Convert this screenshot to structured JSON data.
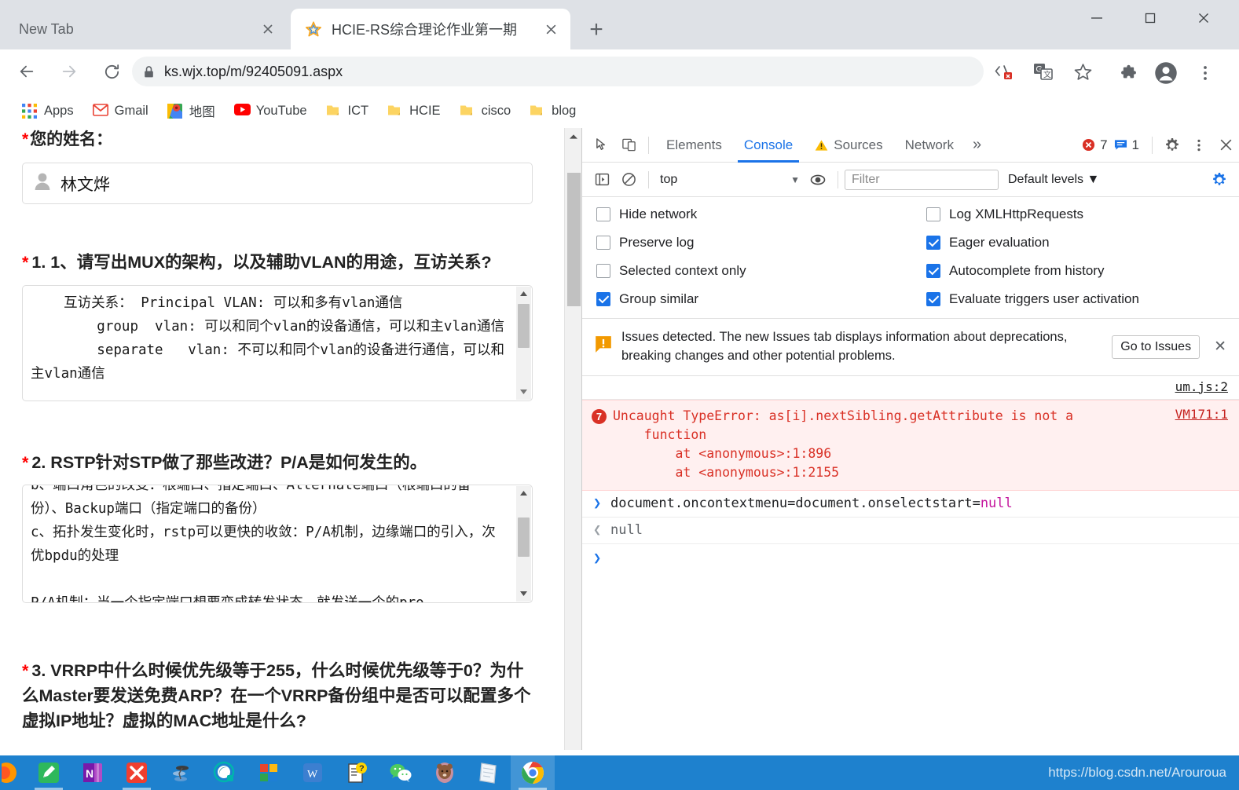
{
  "browser": {
    "tabs": [
      {
        "title": "New Tab",
        "active": false,
        "favicon": "none"
      },
      {
        "title": "HCIE-RS综合理论作业第一期",
        "active": true,
        "favicon": "star-icon"
      }
    ],
    "new_tab_label": "+",
    "window_controls": {
      "minimize": "—",
      "maximize": "□",
      "close": "✕"
    },
    "nav": {
      "back": "←",
      "forward": "→",
      "reload": "⟳"
    },
    "omnibox": {
      "url": "ks.wjx.top/m/92405091.aspx",
      "lock": "lock-icon"
    },
    "omnibox_actions": [
      "devtools-source-icon",
      "translate-icon",
      "bookmark-star-icon"
    ],
    "toolbar_icons": [
      "extensions-puzzle-icon",
      "profile-avatar-icon",
      "chrome-menu-icon"
    ],
    "bookmarks": [
      {
        "label": "Apps",
        "icon": "apps-grid-icon"
      },
      {
        "label": "Gmail",
        "icon": "gmail-icon"
      },
      {
        "label": "地图",
        "icon": "google-maps-icon"
      },
      {
        "label": "YouTube",
        "icon": "youtube-icon"
      },
      {
        "label": "ICT",
        "icon": "folder-icon"
      },
      {
        "label": "HCIE",
        "icon": "folder-icon"
      },
      {
        "label": "cisco",
        "icon": "folder-icon"
      },
      {
        "label": "blog",
        "icon": "folder-icon"
      }
    ]
  },
  "page": {
    "name_field": {
      "label": "您的姓名：",
      "required_marker": "*",
      "value": "林文烨",
      "icon": "person-icon"
    },
    "questions": [
      {
        "required_marker": "*",
        "number": "1.",
        "title": "1、请写出MUX的架构，以及辅助VLAN的用途，互访关系?",
        "answer": "    互访关系： Principal VLAN: 可以和多有vlan通信\n        group  vlan: 可以和同个vlan的设备通信，可以和主vlan通信\n        separate   vlan: 不可以和同个vlan的设备进行通信，可以和主vlan通信"
      },
      {
        "required_marker": "*",
        "number": "2.",
        "title": "RSTP针对STP做了那些改进？P/A是如何发生的。",
        "answer_clipped_top": "b、端口角色的改变：根端口、指定端口、Alternate端口（根端口的备份）、Backup端口（指定端口的备份）\nc、拓扑发生变化时，rstp可以更快的收敛：P/A机制，边缘端口的引入，次优bpdu的处理\n\nP/A机制：当一个指定端口想要变成转发状态，就发送一个的pro"
      },
      {
        "required_marker": "*",
        "number": "3.",
        "title": "VRRP中什么时候优先级等于255，什么时候优先级等于0？为什么Master要发送免费ARP？在一个VRRP备份组中是否可以配置多个虚拟IP地址？虚拟的MAC地址是什么?"
      }
    ]
  },
  "devtools": {
    "toolbar_icons": [
      "inspect-element-icon",
      "device-toolbar-icon"
    ],
    "tabs": [
      {
        "label": "Elements",
        "selected": false,
        "icon": null
      },
      {
        "label": "Console",
        "selected": true,
        "icon": null
      },
      {
        "label": "Sources",
        "selected": false,
        "icon": "warning-triangle-icon"
      },
      {
        "label": "Network",
        "selected": false,
        "icon": null
      }
    ],
    "more_tabs": "»",
    "counts": {
      "errors": "7",
      "messages": "1"
    },
    "actions": [
      "settings-gear-icon",
      "devtools-menu-icon",
      "close-devtools-icon"
    ],
    "console_toolbar": {
      "sidebar_toggle": "console-sidebar-icon",
      "clear": "clear-console-icon",
      "context": "top",
      "context_caret": "▼",
      "eye": "live-expression-icon",
      "filter_placeholder": "Filter",
      "levels": "Default levels",
      "levels_caret": "▼",
      "settings": "console-settings-gear-icon"
    },
    "settings": [
      {
        "label": "Hide network",
        "checked": false
      },
      {
        "label": "Log XMLHttpRequests",
        "checked": false
      },
      {
        "label": "Preserve log",
        "checked": false
      },
      {
        "label": "Eager evaluation",
        "checked": true
      },
      {
        "label": "Selected context only",
        "checked": false
      },
      {
        "label": "Autocomplete from history",
        "checked": true
      },
      {
        "label": "Group similar",
        "checked": true
      },
      {
        "label": "Evaluate triggers user activation",
        "checked": true
      }
    ],
    "issues_banner": {
      "icon": "issues-warning-icon",
      "text": "Issues detected. The new Issues tab displays information about deprecations, breaking changes and other potential problems.",
      "button": "Go to Issues",
      "close": "✕"
    },
    "console_messages": [
      {
        "type": "source-only",
        "source": "um.js:2"
      },
      {
        "type": "error",
        "count": "7",
        "text": "Uncaught TypeError: as[i].nextSibling.getAttribute is not a\n    function\n        at <anonymous>:1:896\n        at <anonymous>:1:2155",
        "source": "VM171:1"
      },
      {
        "type": "input",
        "arrow": "❯",
        "text": "document.oncontextmenu=document.onselectstart=",
        "keyword": "null"
      },
      {
        "type": "output",
        "arrow": "❮",
        "text": "null"
      },
      {
        "type": "prompt",
        "arrow": "❯",
        "text": ""
      }
    ]
  },
  "taskbar": {
    "items": [
      {
        "name": "firefox-icon",
        "open": false
      },
      {
        "name": "notes-pencil-icon",
        "open": true
      },
      {
        "name": "onenote-icon",
        "open": false
      },
      {
        "name": "xmind-icon",
        "open": true
      },
      {
        "name": "ensp-icon",
        "open": false
      },
      {
        "name": "qq-browser-icon",
        "open": false
      },
      {
        "name": "office-icon",
        "open": false
      },
      {
        "name": "wps-writer-icon",
        "open": false
      },
      {
        "name": "question-doc-icon",
        "open": false
      },
      {
        "name": "wechat-icon",
        "open": false
      },
      {
        "name": "bear-avatar-icon",
        "open": false
      },
      {
        "name": "notepad-icon",
        "open": false
      },
      {
        "name": "chrome-icon",
        "open": true,
        "active": true
      }
    ],
    "watermark": "https://blog.csdn.net/Arouroua"
  }
}
